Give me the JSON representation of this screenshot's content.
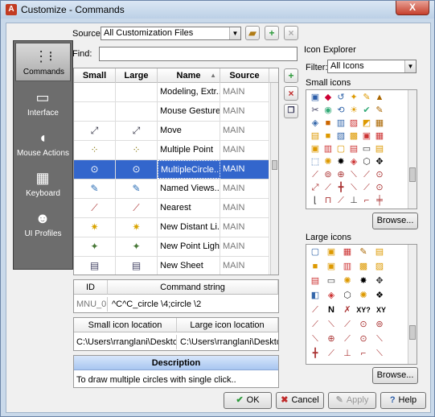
{
  "window": {
    "title": "Customize - Commands",
    "close_label": "X"
  },
  "source": {
    "label": "Source:",
    "value": "All Customization Files"
  },
  "find": {
    "label": "Find:",
    "value": ""
  },
  "nav": [
    {
      "label": "Commands",
      "icon": "commands-icon",
      "glyph": "⋮⁝"
    },
    {
      "label": "Interface",
      "icon": "monitor-icon",
      "glyph": "▭"
    },
    {
      "label": "Mouse Actions",
      "icon": "mouse-icon",
      "glyph": "◖"
    },
    {
      "label": "Keyboard",
      "icon": "keyboard-icon",
      "glyph": "▦"
    },
    {
      "label": "UI Profiles",
      "icon": "profiles-icon",
      "glyph": "☻"
    }
  ],
  "commands_table": {
    "headers": [
      "Small",
      "Large",
      "Name",
      "Source"
    ],
    "rows": [
      {
        "name": "Modeling, Extr...",
        "source": "MAIN",
        "small": "",
        "large": ""
      },
      {
        "name": "Mouse Gestures",
        "source": "MAIN",
        "small": "",
        "large": ""
      },
      {
        "name": "Move",
        "source": "MAIN",
        "small": "⤢",
        "large": "⤢"
      },
      {
        "name": "Multiple Point",
        "source": "MAIN",
        "small": "⁘",
        "large": "⁘"
      },
      {
        "name": "MultipleCircle...",
        "source": "MAIN",
        "small": "⊙",
        "large": "⊙"
      },
      {
        "name": "Named Views...",
        "source": "MAIN",
        "small": "✎",
        "large": "✎"
      },
      {
        "name": "Nearest",
        "source": "MAIN",
        "small": "⟋",
        "large": "⟋"
      },
      {
        "name": "New Distant Li...",
        "source": "MAIN",
        "small": "✷",
        "large": "✷"
      },
      {
        "name": "New Point Light",
        "source": "MAIN",
        "small": "✦",
        "large": "✦"
      },
      {
        "name": "New Sheet",
        "source": "MAIN",
        "small": "▤",
        "large": "▤"
      }
    ],
    "selected_index": 4
  },
  "command_info": {
    "id_label": "ID",
    "cmd_label": "Command string",
    "id_value": "MNU_0",
    "cmd_value": "^C^C_circle \\4;circle \\2"
  },
  "icon_locations": {
    "small_label": "Small icon location",
    "large_label": "Large icon location",
    "small_value": "C:\\Users\\rranglani\\Deskto...",
    "large_value": "C:\\Users\\rranglani\\Deskto..."
  },
  "description": {
    "label": "Description",
    "value": "To draw multiple circles with single click.."
  },
  "icon_explorer": {
    "title": "Icon Explorer",
    "filter_label": "Filter:",
    "filter_value": "All Icons",
    "small_label": "Small icons",
    "large_label": "Large icons",
    "browse_label": "Browse...",
    "large_xy": [
      "XY?",
      "XY"
    ]
  },
  "buttons": {
    "ok": "OK",
    "cancel": "Cancel",
    "apply": "Apply",
    "help": "Help"
  },
  "colors": {
    "selection": "#3366cc",
    "nav_bg": "#6d6d6d",
    "desc_header": "#3c6cc8"
  }
}
